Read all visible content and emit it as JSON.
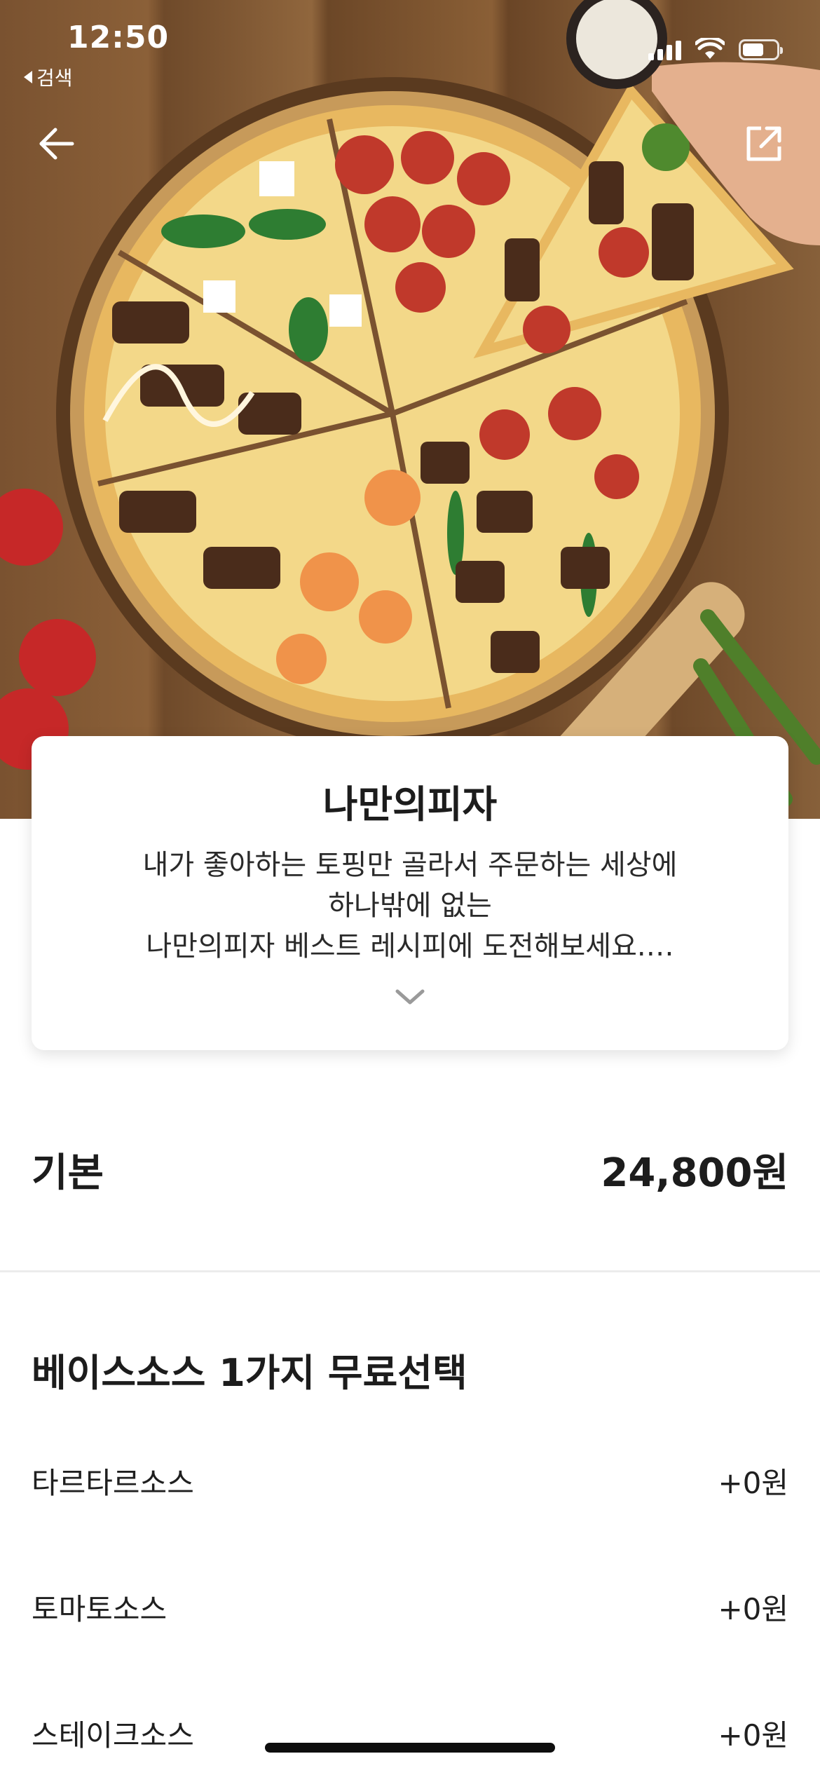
{
  "status_bar": {
    "time": "12:50",
    "back_app_label": "검색"
  },
  "product": {
    "name": "나만의피자",
    "description_lines": [
      "내가 좋아하는 토핑만 골라서 주문하는 세상에",
      "하나밖에 없는",
      "나만의피자 베스트 레시피에 도전해보세요.…"
    ]
  },
  "price": {
    "label": "기본",
    "value": "24,800원"
  },
  "option_group": {
    "title": "베이스소스 1가지 무료선택",
    "options": [
      {
        "label": "타르타르소스",
        "price": "+0원"
      },
      {
        "label": "토마토소스",
        "price": "+0원"
      },
      {
        "label": "스테이크소스",
        "price": "+0원"
      }
    ]
  },
  "icons": {
    "back": "arrow-left-icon",
    "share": "share-icon",
    "expand": "chevron-down-icon"
  },
  "colors": {
    "text": "#1c1c1c",
    "divider": "#ececec",
    "background": "#ffffff"
  }
}
